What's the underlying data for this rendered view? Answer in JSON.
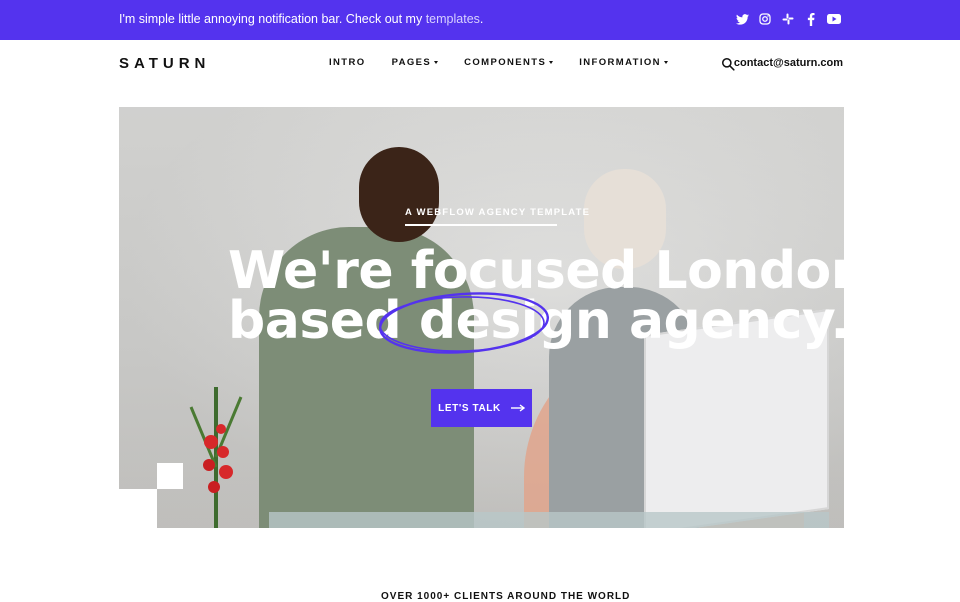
{
  "notification": {
    "text": "I'm simple little annoying notification bar. Check out my ",
    "link_text": "templates",
    "suffix": ".",
    "socials": [
      "twitter-icon",
      "instagram-icon",
      "slack-icon",
      "facebook-icon",
      "youtube-icon"
    ]
  },
  "header": {
    "logo": "SATURN",
    "nav": [
      {
        "label": "INTRO",
        "dropdown": false
      },
      {
        "label": "PAGES",
        "dropdown": true
      },
      {
        "label": "COMPONENTS",
        "dropdown": true
      },
      {
        "label": "INFORMATION",
        "dropdown": true
      }
    ],
    "contact": "contact@saturn.com"
  },
  "hero": {
    "eyebrow": "A WEBFLOW AGENCY TEMPLATE",
    "headline_line1": "We're focused London",
    "headline_line2": "based design agency.",
    "cta_label": "LET'S TALK"
  },
  "clients_heading": "OVER 1000+ CLIENTS AROUND THE WORLD",
  "colors": {
    "accent": "#5433ee",
    "text": "#111111",
    "white": "#ffffff"
  }
}
